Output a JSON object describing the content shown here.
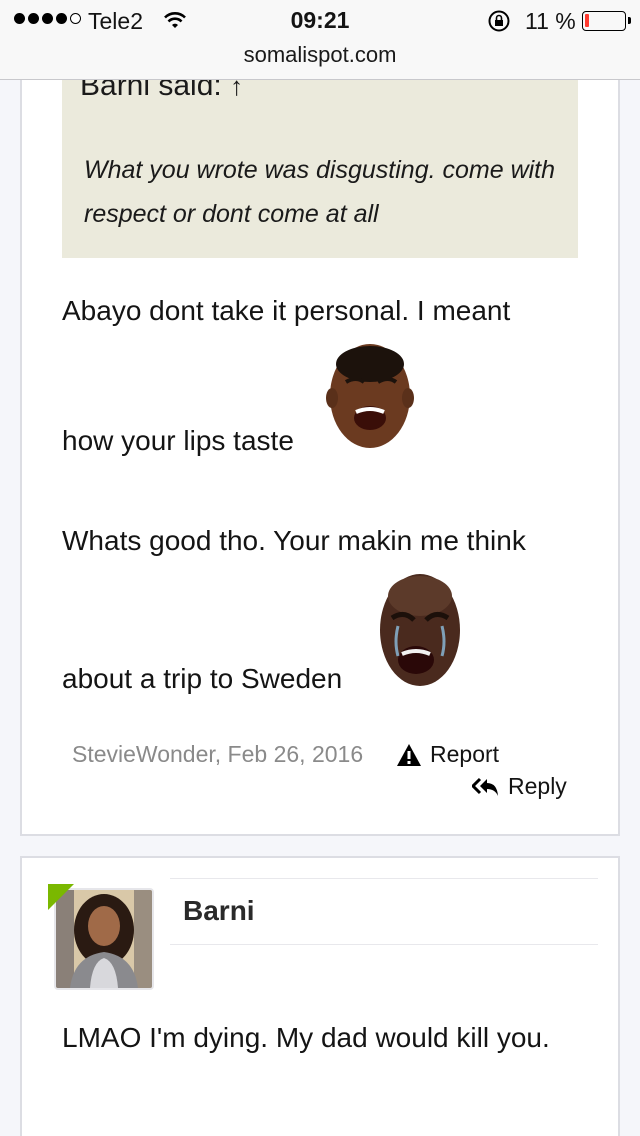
{
  "status_bar": {
    "carrier": "Tele2",
    "time": "09:21",
    "battery_percent": "11 %",
    "battery_level": 0.11,
    "signal_bars_filled": 4,
    "signal_bars_total": 5
  },
  "browser": {
    "url": "somalispot.com"
  },
  "post1": {
    "quote": {
      "author_line": "Barni said:",
      "caret": "↑",
      "text": "What you wrote was disgusting. come with respect or dont come at all"
    },
    "lines": [
      "Abayo dont take it personal. I meant",
      "how your lips taste",
      "Whats good tho. Your makin me think",
      "about a trip to Sweden"
    ],
    "emojis": [
      "laughing-face-emoji",
      "crying-face-emoji"
    ],
    "meta": "StevieWonder, Feb 26, 2016",
    "report_label": "Report",
    "reply_label": "Reply"
  },
  "post2": {
    "username": "Barni",
    "message": "LMAO I'm dying. My dad would kill you.",
    "online_color": "#7ab800"
  },
  "colors": {
    "page_bg": "#f5f6fa",
    "quote_bg": "#ebeadc",
    "meta_text": "#8a8a8a",
    "battery_low": "#ff3b30"
  }
}
